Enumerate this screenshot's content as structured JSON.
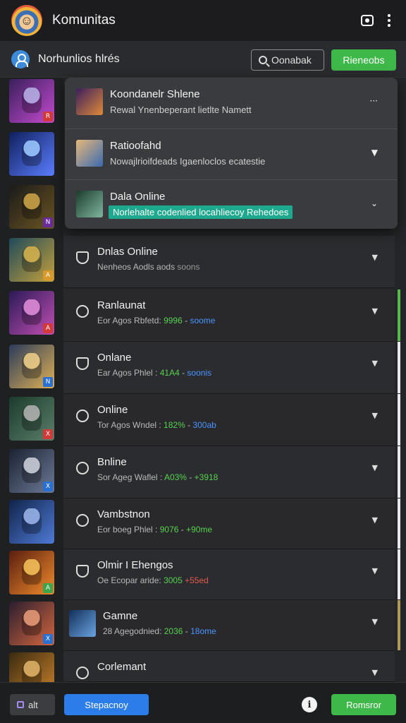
{
  "app": {
    "title": "Komunitas",
    "logo_icon": "app-logo-icon"
  },
  "subheader": {
    "title": "Norhunlios hlrés",
    "search_label": "Oonabak",
    "primary_label": "Rieneobs"
  },
  "popover": {
    "items": [
      {
        "title": "Koondanelr Shlene",
        "subtitle": "Rewal Ynenbeperant lietlte Namett",
        "chevron": "···",
        "highlight": false
      },
      {
        "title": "Ratioofahd",
        "subtitle": "Nowajlrioifdeads Igaenloclos ecatestie",
        "chevron": "▼",
        "highlight": false
      },
      {
        "title": "Dala Online",
        "subtitle": "Norlehalte codenlied locahliecoy Rehedoes",
        "chevron": "⌄",
        "highlight": true
      }
    ]
  },
  "rows": [
    {
      "title": "Dnlas Online",
      "sub_parts": [
        {
          "t": "Nenheos Aodls aods",
          "c": ""
        },
        {
          "t": "  soons",
          "c": "m"
        }
      ],
      "accent": "",
      "icon": "shield"
    },
    {
      "title": "Ranlaunat",
      "sub_parts": [
        {
          "t": "Eor Agos Rbfetd: ",
          "c": ""
        },
        {
          "t": "9996",
          "c": "g"
        },
        {
          "t": " - ",
          "c": ""
        },
        {
          "t": "soome",
          "c": "b"
        }
      ],
      "accent": "#59b94a",
      "icon": "circle"
    },
    {
      "title": "Onlane",
      "sub_parts": [
        {
          "t": "Ear Agos Phlel : ",
          "c": ""
        },
        {
          "t": "41A4",
          "c": "g"
        },
        {
          "t": " - ",
          "c": ""
        },
        {
          "t": "soonis",
          "c": "b"
        }
      ],
      "accent": "#e8e8e8",
      "icon": "shield"
    },
    {
      "title": "Online",
      "sub_parts": [
        {
          "t": "Tor Agos Wndel : ",
          "c": ""
        },
        {
          "t": "182%",
          "c": "g"
        },
        {
          "t": " - ",
          "c": ""
        },
        {
          "t": "300ab",
          "c": "b"
        }
      ],
      "accent": "#e8e8e8",
      "icon": "circle"
    },
    {
      "title": "Bnline",
      "sub_parts": [
        {
          "t": "Sor Ageg Waflel : ",
          "c": ""
        },
        {
          "t": "A03%",
          "c": "g"
        },
        {
          "t": " - ",
          "c": ""
        },
        {
          "t": "+3918",
          "c": "g"
        }
      ],
      "accent": "#e8e8e8",
      "icon": "circle"
    },
    {
      "title": "Vambstnon",
      "sub_parts": [
        {
          "t": "Eor boeg Phlel : ",
          "c": ""
        },
        {
          "t": "9076",
          "c": "g"
        },
        {
          "t": " - ",
          "c": ""
        },
        {
          "t": "+90me",
          "c": "g"
        }
      ],
      "accent": "#e8e8e8",
      "icon": "circle"
    },
    {
      "title": "Olmir I Ehengos",
      "sub_parts": [
        {
          "t": "Oe Ecopar aride: ",
          "c": ""
        },
        {
          "t": "3005",
          "c": "g"
        },
        {
          "t": "  ",
          "c": ""
        },
        {
          "t": "+55ed",
          "c": "r"
        }
      ],
      "accent": "#e8e8e8",
      "icon": "shield"
    },
    {
      "title": "Gamne",
      "sub_parts": [
        {
          "t": "28 Agegodnied: ",
          "c": ""
        },
        {
          "t": "2036",
          "c": "g"
        },
        {
          "t": " - ",
          "c": ""
        },
        {
          "t": "18ome",
          "c": "b"
        }
      ],
      "accent": "#b09a5a",
      "icon": "thumb"
    },
    {
      "title": "Corlemant",
      "sub_parts": [
        {
          "t": "",
          "c": ""
        }
      ],
      "accent": "",
      "icon": "circle"
    }
  ],
  "thumbs": [
    {
      "colors": [
        "#3a1f5c",
        "#c44bd1"
      ],
      "fig": "#b7b3e6",
      "badge": "#d23a3a",
      "badge_text": "R"
    },
    {
      "colors": [
        "#0f1f5c",
        "#5b7dff"
      ],
      "fig": "#9ecbff",
      "badge": "",
      "badge_text": ""
    },
    {
      "colors": [
        "#1a1a1a",
        "#6b5522"
      ],
      "fig": "#d0a749",
      "badge": "#6a2b9e",
      "badge_text": "N"
    },
    {
      "colors": [
        "#1f4a5a",
        "#c5a13c"
      ],
      "fig": "#d7b24d",
      "badge": "#d99a2a",
      "badge_text": "A"
    },
    {
      "colors": [
        "#2a1a55",
        "#c24fb5"
      ],
      "fig": "#e18fd8",
      "badge": "#d23a3a",
      "badge_text": "A"
    },
    {
      "colors": [
        "#2b3b5a",
        "#e0b256"
      ],
      "fig": "#f0d08a",
      "badge": "#2a6fd2",
      "badge_text": "N"
    },
    {
      "colors": [
        "#1c3b2c",
        "#5a7f6a"
      ],
      "fig": "#b4b4b4",
      "badge": "#d23a3a",
      "badge_text": "X"
    },
    {
      "colors": [
        "#1b2233",
        "#6d7a95"
      ],
      "fig": "#cfd3dc",
      "badge": "#2a6fd2",
      "badge_text": "X"
    },
    {
      "colors": [
        "#11234a",
        "#4e7ad6"
      ],
      "fig": "#9bb6e8",
      "badge": "",
      "badge_text": ""
    },
    {
      "colors": [
        "#5a1e0f",
        "#f08b2c"
      ],
      "fig": "#f5c35a",
      "badge": "#3fa54a",
      "badge_text": "A"
    },
    {
      "colors": [
        "#2a1d2e",
        "#d4673f"
      ],
      "fig": "#e89c78",
      "badge": "#2a6fd2",
      "badge_text": "X"
    },
    {
      "colors": [
        "#3a2a10",
        "#c9822b"
      ],
      "fig": "#e0b46a",
      "badge": "",
      "badge_text": ""
    }
  ],
  "bottombar": {
    "filter_label": "alt",
    "blue_label": "Stepacnoy",
    "info_icon": "i",
    "green_label": "Romsror"
  }
}
